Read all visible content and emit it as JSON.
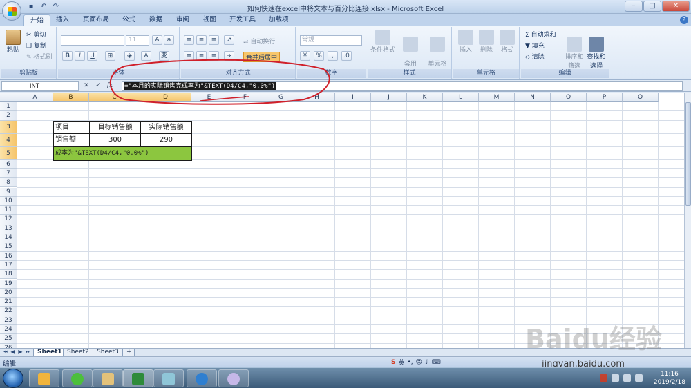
{
  "window": {
    "title": "如何快速在excel中将文本与百分比连接.xlsx - Microsoft Excel",
    "controls": [
      "–",
      "□",
      "✕"
    ]
  },
  "ribbon_tabs": [
    "开始",
    "插入",
    "页面布局",
    "公式",
    "数据",
    "审阅",
    "视图",
    "开发工具",
    "加载项"
  ],
  "ribbon": {
    "clipboard": {
      "paste": "粘贴",
      "cut": "剪切",
      "copy": "复制",
      "format_painter": "格式刷",
      "label": "剪贴板"
    },
    "font": {
      "size": "11",
      "label": "字体",
      "bold": "B",
      "italic": "I",
      "underline": "U"
    },
    "alignment": {
      "wrap": "自动换行",
      "merge": "合并后居中",
      "label": "对齐方式"
    },
    "number": {
      "format": "常规",
      "percent": "%",
      "label": "数字"
    },
    "styles": {
      "conditional": "条件格式",
      "table": "套用\n表格格式",
      "cell_styles": "单元格\n样式",
      "label": "样式"
    },
    "cells": {
      "insert": "插入",
      "delete": "删除",
      "format": "格式",
      "label": "单元格"
    },
    "editing": {
      "autosum": "Σ 自动求和",
      "fill": "填充",
      "clear": "清除",
      "sort": "排序和\n筛选",
      "find": "查找和\n选择",
      "label": "编辑"
    }
  },
  "formula_bar": {
    "name_box": "INT",
    "formula": "=\"本月的实际销售完成率为\"&TEXT(D4/C4,\"0.0%\")"
  },
  "columns": [
    "A",
    "B",
    "C",
    "D",
    "E",
    "F",
    "G",
    "H",
    "I",
    "J",
    "K",
    "L",
    "M",
    "N",
    "O",
    "P",
    "Q"
  ],
  "rows": [
    "1",
    "2",
    "3",
    "4",
    "5",
    "6",
    "7",
    "8",
    "9",
    "10",
    "11",
    "12",
    "13",
    "14",
    "15",
    "16",
    "17",
    "18",
    "19",
    "20",
    "21",
    "22",
    "23",
    "24",
    "25",
    "26"
  ],
  "cells": {
    "B3": "项目",
    "C3": "目标销售额",
    "D3": "实际销售额",
    "B4": "销售额",
    "C4": "300",
    "D4": "290",
    "B5": "成率为\"&TEXT(D4/C4,\"0.0%\")"
  },
  "sheets": [
    "Sheet1",
    "Sheet2",
    "Sheet3"
  ],
  "status": {
    "mode": "编辑",
    "ime": "英"
  },
  "taskbar": {
    "time": "11:16",
    "date": "2019/2/18"
  },
  "watermark": {
    "logo": "Baidu经验",
    "url": "jingyan.baidu.com"
  },
  "colors": {
    "accent_tab": "#eef4fb",
    "selection_header": "#f5c46b",
    "result_cell": "#8cc63f",
    "annotation": "#d0202a"
  }
}
